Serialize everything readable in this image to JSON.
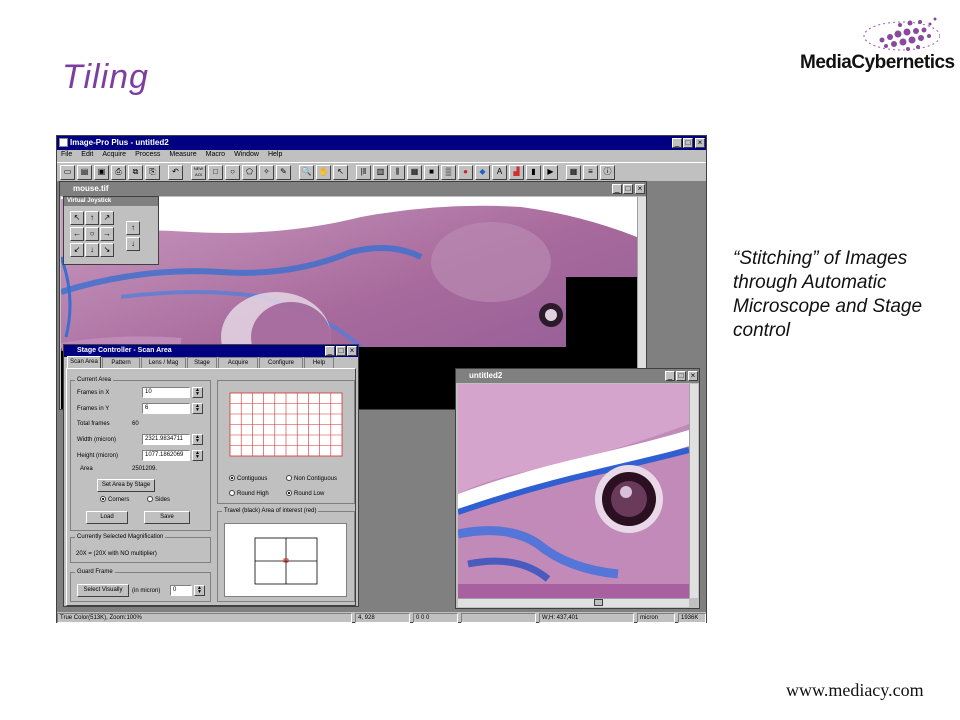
{
  "slide": {
    "title": "Tiling",
    "caption": "“Stitching” of Images through Automatic Microscope and Stage control",
    "website": "www.mediacy.com",
    "accent_color": "#7b3fa0"
  },
  "logo": {
    "text": "MediaCybernetics",
    "color": "#8a4a9c"
  },
  "app": {
    "title": "Image-Pro Plus - untitled2",
    "menu": [
      "File",
      "Edit",
      "Acquire",
      "Process",
      "Measure",
      "Macro",
      "Window",
      "Help"
    ],
    "toolbar_icons": [
      "new-icon",
      "open-icon",
      "save-icon",
      "print-icon",
      "copy-icon",
      "paste-icon",
      "undo-icon",
      "new-aoi-icon",
      "rect-icon",
      "ellipse-icon",
      "polygon-icon",
      "wand-icon",
      "pencil-icon",
      "zoom-icon",
      "hand-icon",
      "pointer-icon",
      "measure-icon",
      "histogram-icon",
      "profile-icon",
      "filter-icon",
      "mask-icon",
      "calibrate-icon",
      "color-icon",
      "palette-icon",
      "text-icon",
      "chart-icon",
      "bar-icon",
      "film-icon",
      "macro-icon",
      "script-icon",
      "info-icon"
    ],
    "toolbar_new_aoi": "NEW AOI",
    "status": {
      "color": "True Color(513K), Zoom:100%",
      "coords": "4, 928",
      "value": "0  0  0",
      "wh": "W,H: 437,401",
      "unit": "micron",
      "mem": "1936K"
    }
  },
  "mouse_window": {
    "title": "mouse.tif"
  },
  "joystick": {
    "title": "Virtual Joystick",
    "arrows": [
      "↖",
      "↑",
      "↗",
      "←",
      "○",
      "→",
      "↙",
      "↓",
      "↘"
    ],
    "z_arrows": [
      "↑",
      "↓"
    ]
  },
  "stage": {
    "title": "Stage Controller - Scan Area",
    "tabs": [
      "Scan Area",
      "Pattern",
      "Lens / Mag",
      "Stage",
      "Acquire",
      "Configure",
      "Help"
    ],
    "current_area_label": "Current Area",
    "frames_x_label": "Frames in X",
    "frames_x": "10",
    "frames_y_label": "Frames in Y",
    "frames_y": "6",
    "total_frames_label": "Total frames",
    "total_frames": "60",
    "width_label": "Width (micron)",
    "width": "2321.9834711",
    "height_label": "Height (micron)",
    "height": "1077.1862069",
    "area_label": "Area",
    "area": "2501209.",
    "set_area_button": "Set Area by Stage",
    "corners_label": "Corners",
    "sides_label": "Sides",
    "load_button": "Load",
    "save_button": "Save",
    "mag_group": "Currently Selected Magnification",
    "mag_value": "20X = (20X with NO multiplier)",
    "guard_group": "Guard Frame",
    "select_visually_button": "Select Visually",
    "in_micron_label": "(in micron)",
    "guard_value": "0",
    "pattern_options": [
      "Contiguous",
      "Non Contiguous",
      "Round High",
      "Round Low"
    ],
    "travel_label": "Travel (black)  Area of interest (red)",
    "grid_cols": 10,
    "grid_rows": 6
  },
  "untitled_window": {
    "title": "untitled2"
  }
}
